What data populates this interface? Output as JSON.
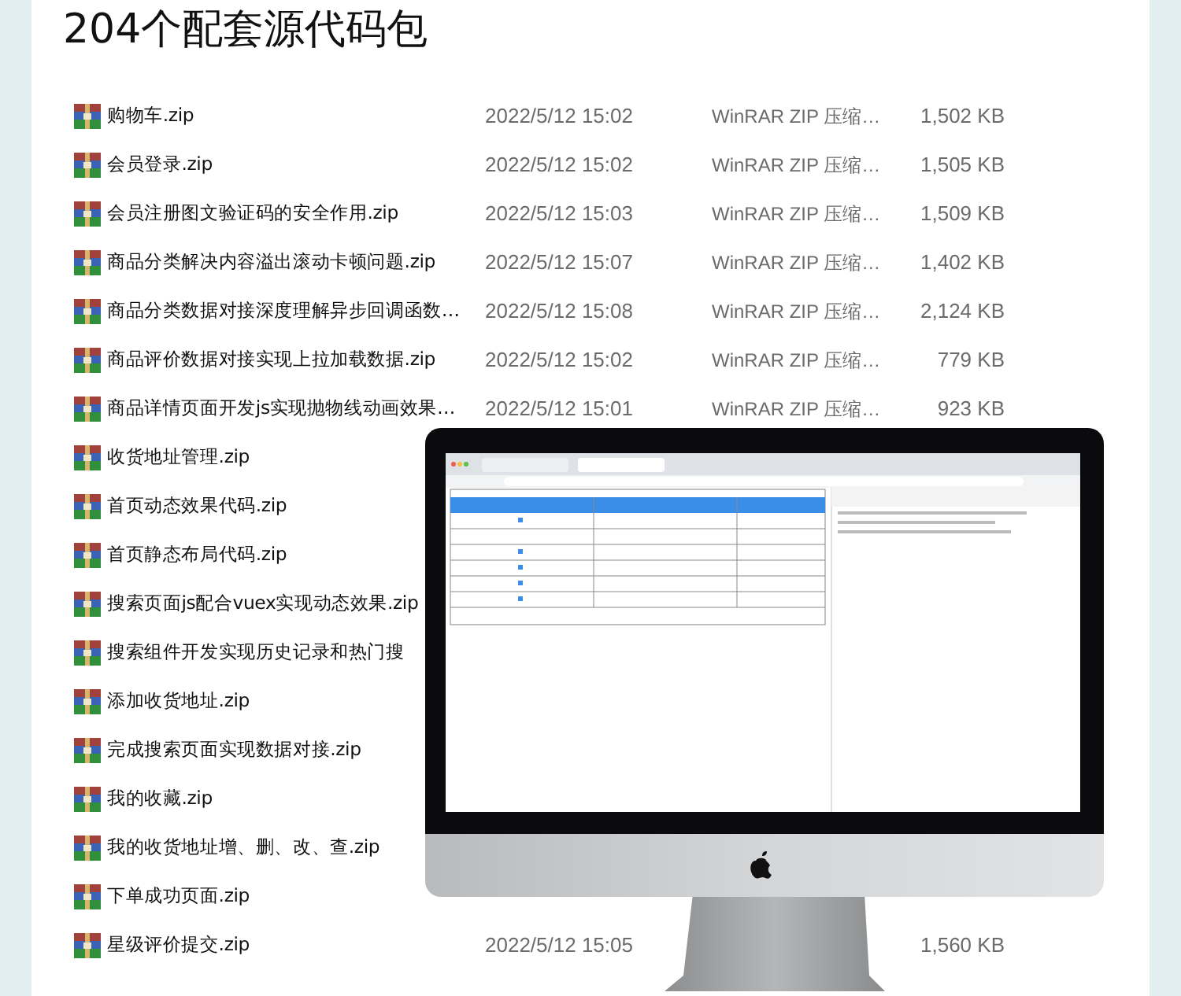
{
  "title": "204个配套源代码包",
  "files": [
    {
      "name": "购物车.zip",
      "date": "2022/5/12 15:02",
      "type": "WinRAR ZIP 压缩…",
      "size": "1,502 KB"
    },
    {
      "name": "会员登录.zip",
      "date": "2022/5/12 15:02",
      "type": "WinRAR ZIP 压缩…",
      "size": "1,505 KB"
    },
    {
      "name": "会员注册图文验证码的安全作用.zip",
      "date": "2022/5/12 15:03",
      "type": "WinRAR ZIP 压缩…",
      "size": "1,509 KB"
    },
    {
      "name": "商品分类解决内容溢出滚动卡顿问题.zip",
      "date": "2022/5/12 15:07",
      "type": "WinRAR ZIP 压缩…",
      "size": "1,402 KB"
    },
    {
      "name": "商品分类数据对接深度理解异步回调函数…",
      "date": "2022/5/12 15:08",
      "type": "WinRAR ZIP 压缩…",
      "size": "2,124 KB"
    },
    {
      "name": "商品评价数据对接实现上拉加载数据.zip",
      "date": "2022/5/12 15:02",
      "type": "WinRAR ZIP 压缩…",
      "size": "779 KB"
    },
    {
      "name": "商品详情页面开发js实现抛物线动画效果…",
      "date": "2022/5/12 15:01",
      "type": "WinRAR ZIP 压缩…",
      "size": "923 KB"
    },
    {
      "name": "收货地址管理.zip"
    },
    {
      "name": "首页动态效果代码.zip"
    },
    {
      "name": "首页静态布局代码.zip"
    },
    {
      "name": "搜索页面js配合vuex实现动态效果.zip"
    },
    {
      "name": "搜索组件开发实现历史记录和热门搜"
    },
    {
      "name": "添加收货地址.zip"
    },
    {
      "name": "完成搜索页面实现数据对接.zip"
    },
    {
      "name": "我的收藏.zip"
    },
    {
      "name": "我的收货地址增、删、改、查.zip"
    },
    {
      "name": "下单成功页面.zip"
    },
    {
      "name": "星级评价提交.zip",
      "date": "2022/5/12 15:05",
      "size": "1,560 KB"
    }
  ]
}
